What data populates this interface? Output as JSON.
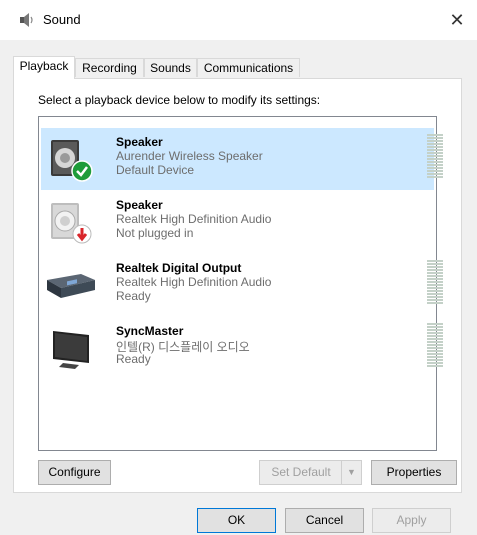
{
  "window": {
    "title": "Sound",
    "close_glyph": "✕"
  },
  "tabs": [
    {
      "label": "Playback",
      "active": true
    },
    {
      "label": "Recording",
      "active": false
    },
    {
      "label": "Sounds",
      "active": false
    },
    {
      "label": "Communications",
      "active": false
    }
  ],
  "panel": {
    "instruction": "Select a playback device below to modify its settings:"
  },
  "devices": [
    {
      "name": "Speaker",
      "description": "Aurender Wireless Speaker",
      "status": "Default Device",
      "icon": "speaker-icon",
      "badge": "green-check",
      "selected": true
    },
    {
      "name": "Speaker",
      "description": "Realtek High Definition Audio",
      "status": "Not plugged in",
      "icon": "speaker-icon",
      "badge": "red-down-arrow",
      "selected": false
    },
    {
      "name": "Realtek Digital Output",
      "description": "Realtek High Definition Audio",
      "status": "Ready",
      "icon": "digital-output-icon",
      "badge": "",
      "selected": false
    },
    {
      "name": "SyncMaster",
      "description": "인텔(R) 디스플레이 오디오",
      "status": "Ready",
      "icon": "monitor-icon",
      "badge": "",
      "selected": false
    }
  ],
  "buttons": {
    "configure": "Configure",
    "set_default": "Set Default",
    "properties": "Properties",
    "ok": "OK",
    "cancel": "Cancel",
    "apply": "Apply"
  },
  "colors": {
    "selection": "#cce8ff",
    "accent": "#0078d7",
    "ok_badge": "#1e9c3a",
    "error_badge": "#d9262b"
  }
}
